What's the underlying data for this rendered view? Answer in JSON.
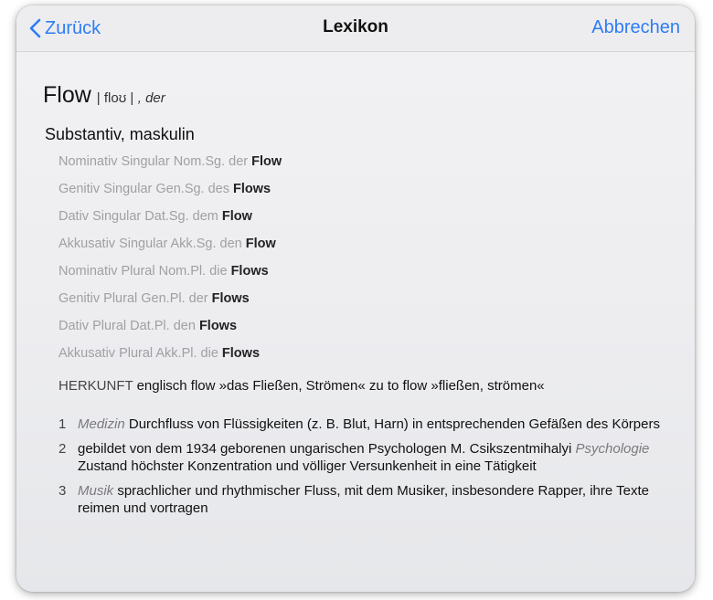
{
  "nav": {
    "back_label": "Zurück",
    "title": "Lexikon",
    "cancel_label": "Abbrechen"
  },
  "entry": {
    "headword": "Flow",
    "pronunciation": "| floʊ |",
    "gender": ", der",
    "part_of_speech": "Substantiv, maskulin",
    "forms": [
      {
        "label": "Nominativ Singular Nom.Sg. der",
        "form": "Flow"
      },
      {
        "label": "Genitiv Singular Gen.Sg. des",
        "form": "Flows"
      },
      {
        "label": "Dativ Singular Dat.Sg. dem",
        "form": "Flow"
      },
      {
        "label": "Akkusativ Singular Akk.Sg. den",
        "form": "Flow"
      },
      {
        "label": "Nominativ Plural Nom.Pl. die",
        "form": "Flows"
      },
      {
        "label": "Genitiv Plural Gen.Pl. der",
        "form": "Flows"
      },
      {
        "label": "Dativ Plural Dat.Pl. den",
        "form": "Flows"
      },
      {
        "label": "Akkusativ Plural Akk.Pl. die",
        "form": "Flows"
      }
    ],
    "herkunft_label": "HERKUNFT",
    "herkunft_text": "englisch flow »das Fließen, Strömen« zu to flow »fließen, strömen«",
    "senses": [
      {
        "num": "1",
        "domain_before": "Medizin",
        "text_before": " Durchfluss von Flüssigkeiten (z. B. Blut, Harn) in entsprechenden Gefäßen des Körpers",
        "domain_mid": "",
        "text_after": ""
      },
      {
        "num": "2",
        "domain_before": "",
        "text_before": "gebildet von dem 1934 geborenen ungarischen Psychologen M. Csikszentmihalyi ",
        "domain_mid": "Psychologie",
        "text_after": " Zustand höchster Konzentration und völliger Versunkenheit in eine Tätigkeit"
      },
      {
        "num": "3",
        "domain_before": "Musik",
        "text_before": " sprachlicher und rhythmischer Fluss, mit dem Musiker, insbesondere Rapper, ihre Texte reimen und vortragen",
        "domain_mid": "",
        "text_after": ""
      }
    ]
  },
  "colors": {
    "accent": "#2d7cf6",
    "form_label": "#a0a0a4",
    "domain_label": "#7a7a7e"
  }
}
